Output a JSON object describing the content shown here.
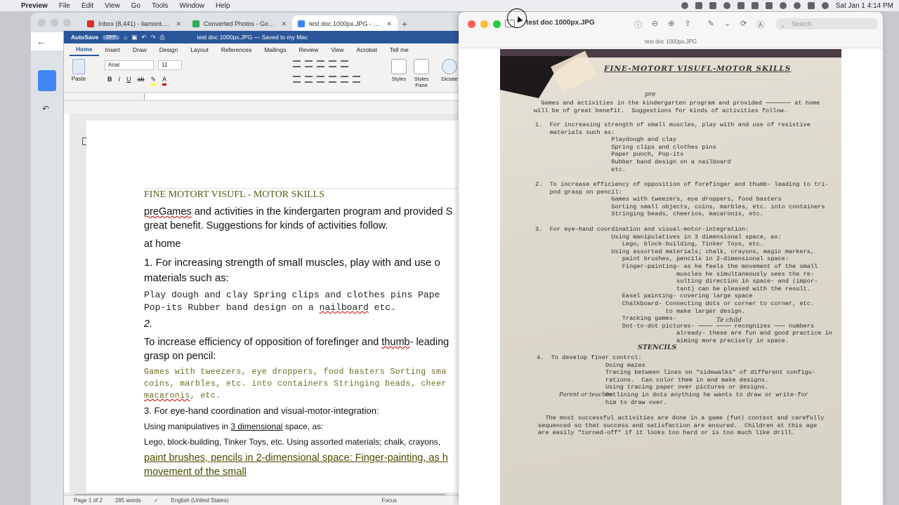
{
  "menubar": {
    "app_name": "Preview",
    "items": [
      "File",
      "Edit",
      "View",
      "Go",
      "Tools",
      "Window",
      "Help"
    ],
    "clock": "Sat Jan 1  4:14 PM"
  },
  "chrome": {
    "tabs": [
      {
        "label": "Inbox (8,441) - ilamont.com@gm",
        "color": "#d93025"
      },
      {
        "label": "Converted Photos - Google Driv",
        "color": "#34a853"
      },
      {
        "label": "test doc 1000px.JPG - Google D",
        "color": "#4285f4"
      }
    ],
    "new_tab": "+"
  },
  "word": {
    "autosave_label": "AutoSave",
    "autosave_state": "OFF",
    "title": "test doc 1000px.JPG — Saved to my Mac",
    "tabs": [
      "Home",
      "Insert",
      "Draw",
      "Design",
      "Layout",
      "References",
      "Mailings",
      "Review",
      "View",
      "Acrobat",
      "Tell me"
    ],
    "paste_label": "Paste",
    "font": "Arial",
    "size": "11",
    "styles_label": "Styles",
    "styles_pane_label": "Styles Pane",
    "dictate_label": "Dictate",
    "status": {
      "page": "Page 1 of 2",
      "words": "285 words",
      "language": "English (United States)",
      "focus": "Focus"
    },
    "doc": {
      "heading": "FINE MOTORT VISUFL - MOTOR SKILLS",
      "l1a": "preGames",
      "l1b": " and activities in the kindergarten program and provided S",
      "l2": "great benefit. Suggestions for kinds of activities follow.",
      "l3": "at home",
      "l4": "1. For increasing strength of small muscles, play with and use o",
      "l5": "materials such as:",
      "l6": "Play dough and clay Spring clips and clothes pins Pape",
      "l7a": "Pop-its Rubber band design on a ",
      "l7b": "nailboard",
      "l7c": " etc.",
      "l8": "2.",
      "l9a": "To increase efficiency of opposition of forefinger and ",
      "l9b": "thumb",
      "l9c": "- leading",
      "l10": "grasp on pencil:",
      "l11": "Games with tweezers, eye droppers, food basters Sorting sma",
      "l12": "coins, marbles, etc. into containers Stringing beads, cheer",
      "l13a": "macaronis",
      "l13b": ", etc.",
      "l14": "3. For eye-hand coordination and visual-motor-integration:",
      "l15a": "Using manipulatives in ",
      "l15b": "3 dimensional",
      "l15c": " space, as:",
      "l16": "Lego, block-building, Tinker Toys, etc. Using assorted materials; chalk, crayons,",
      "l17": "paint brushes, pencils in 2-dimensional space: Finger-painting, as h",
      "l18": "movement of the small"
    }
  },
  "preview": {
    "title": "test doc 1000px.JPG",
    "subtitle": "test doc 1000px.JPG",
    "search_placeholder": "Search",
    "scan": {
      "heading": "FINE-MOTORT VISUFL-MOTOR SKILLS",
      "hw_pre": "pre",
      "p1": "  Games and activities in the kindergarten program and provided ─────── at home\nwill be of great benefit.  Suggestions for kinds of activities follow.",
      "s1": "1.  For increasing strength of small muscles, play with and use of resistive\n    materials such as:\n                     Playdough and clay\n                     Spring clips and clothes pins\n                     Paper punch, Pop-its\n                     Rubber band design on a nailboard\n                     etc.",
      "s2": "2.  To increase efficiency of opposition of forefinger and thumb- leading to tri-\n    pod grasp on pencil:\n                     Games with tweezers, eye droppers, food basters\n                     Sorting small objects, coins, marbles, etc. into containers\n                     Stringing beads, cheerios, macaronis, etc.",
      "s3": "3.  For eye-hand coordination and visual-motor-integration:\n                     Using manipulatives in 3 dimensional space, as:\n                        Lego, block-building, Tinker Toys, etc.\n                     Using assorted materials; chalk, crayons, magic markers,\n                        paint brushes, pencils in 2-dimensional space:\n                        Finger-painting- as he feels the movement of the small\n                                       muscles he simultaneously sees the re-\n                                       sulting direction in space- and (impor-\n                                       tant) can be pleased with the result.\n                        Easel painting- covering large space\n                        Chalkboard- Connecting dots or corner to corner, etc.\n                                    to make larger design.\n                        Tracking games-\n                        Dot-to-dot pictures- ──── ──── recognizes ─── numbers\n                                       already- these are fun and good practice in\n                                       aiming more precisely in space.",
      "hw_child": "Te child",
      "hw_stencils": "STENCILS",
      "s4": "4.  To develop finer control:\n                   Doing mazes\n                   Tracing between lines on \"sidewalks\" of different configu-\n                   rations.  Can color them in and make designs.\n                   Using tracing paper over pictures or designs.\n                   Outlining in dots anything he wants to draw or write-for\n                   him to draw over.",
      "hw_parent": "Parent or teacher",
      "closing": "  The most successful activities are done in a game (fun) context and carefully\nsequenced so that success and satisfaction are ensured.  Children at this age\nare easily \"turned-off\" if it looks too hard or is too much like drill."
    }
  }
}
